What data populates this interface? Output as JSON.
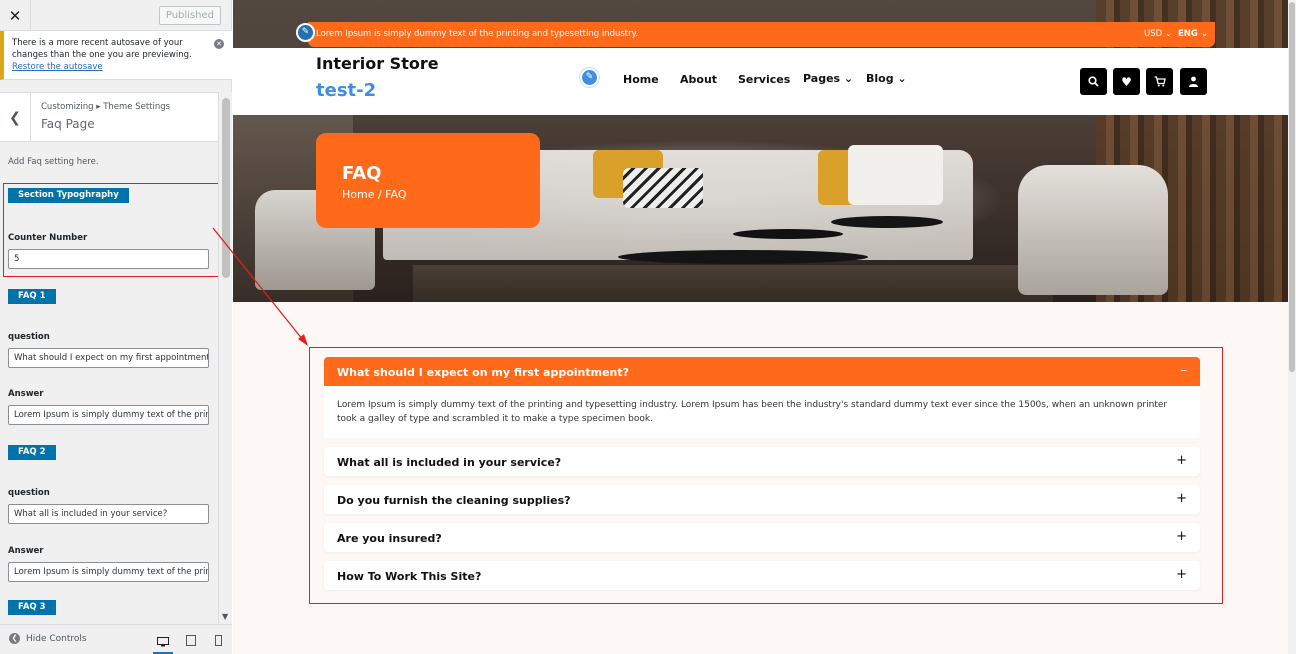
{
  "customizer": {
    "close": "✕",
    "published": "Published",
    "notice": {
      "text": "There is a more recent autosave of your changes than the one you are previewing.",
      "link": "Restore the autosave"
    },
    "breadcrumb": "Customizing ▸ Theme Settings",
    "panel_title": "Faq Page",
    "description": "Add Faq setting here.",
    "section_badge": "Section Typoghraphy",
    "counter_label": "Counter Number",
    "counter_value": "5",
    "faq1_badge": "FAQ 1",
    "faq1_question_label": "question",
    "faq1_question_value": "What should I expect on my first appointment?",
    "faq1_answer_label": "Answer",
    "faq1_answer_value": "Lorem Ipsum is simply dummy text of the printing and typesetting industry.",
    "faq2_badge": "FAQ 2",
    "faq2_question_label": "question",
    "faq2_question_value": "What all is included in your service?",
    "faq2_answer_label": "Answer",
    "faq2_answer_value": "Lorem Ipsum is simply dummy text of the printing and typesetting industry.",
    "faq3_badge": "FAQ 3",
    "hide_controls": "Hide Controls"
  },
  "site": {
    "topbar_text": "Lorem Ipsum is simply dummy text of the printing and typesetting industry.",
    "currency": "USD",
    "language": "ENG",
    "name": "Interior Store",
    "tagline": "test-2",
    "nav": [
      "Home",
      "About",
      "Services",
      "Pages",
      "Blog"
    ],
    "banner_title": "FAQ",
    "banner_breadcrumb": "Home / FAQ",
    "faqs": [
      {
        "question": "What should I expect on my first appointment?",
        "answer": "Lorem Ipsum is simply dummy text of the printing and typesetting industry. Lorem Ipsum has been the industry's standard dummy text ever since the 1500s, when an unknown printer took a galley of type and scrambled it to make a type specimen book.",
        "sign": "–"
      },
      {
        "question": "What all is included in your service?",
        "sign": "+"
      },
      {
        "question": "Do you furnish the cleaning supplies?",
        "sign": "+"
      },
      {
        "question": "Are you insured?",
        "sign": "+"
      },
      {
        "question": "How To Work This Site?",
        "sign": "+"
      }
    ]
  },
  "colors": {
    "accent": "#ff6a1a",
    "wp_blue": "#0073aa",
    "highlight": "#e02020",
    "tagline": "#3f8fe0"
  }
}
